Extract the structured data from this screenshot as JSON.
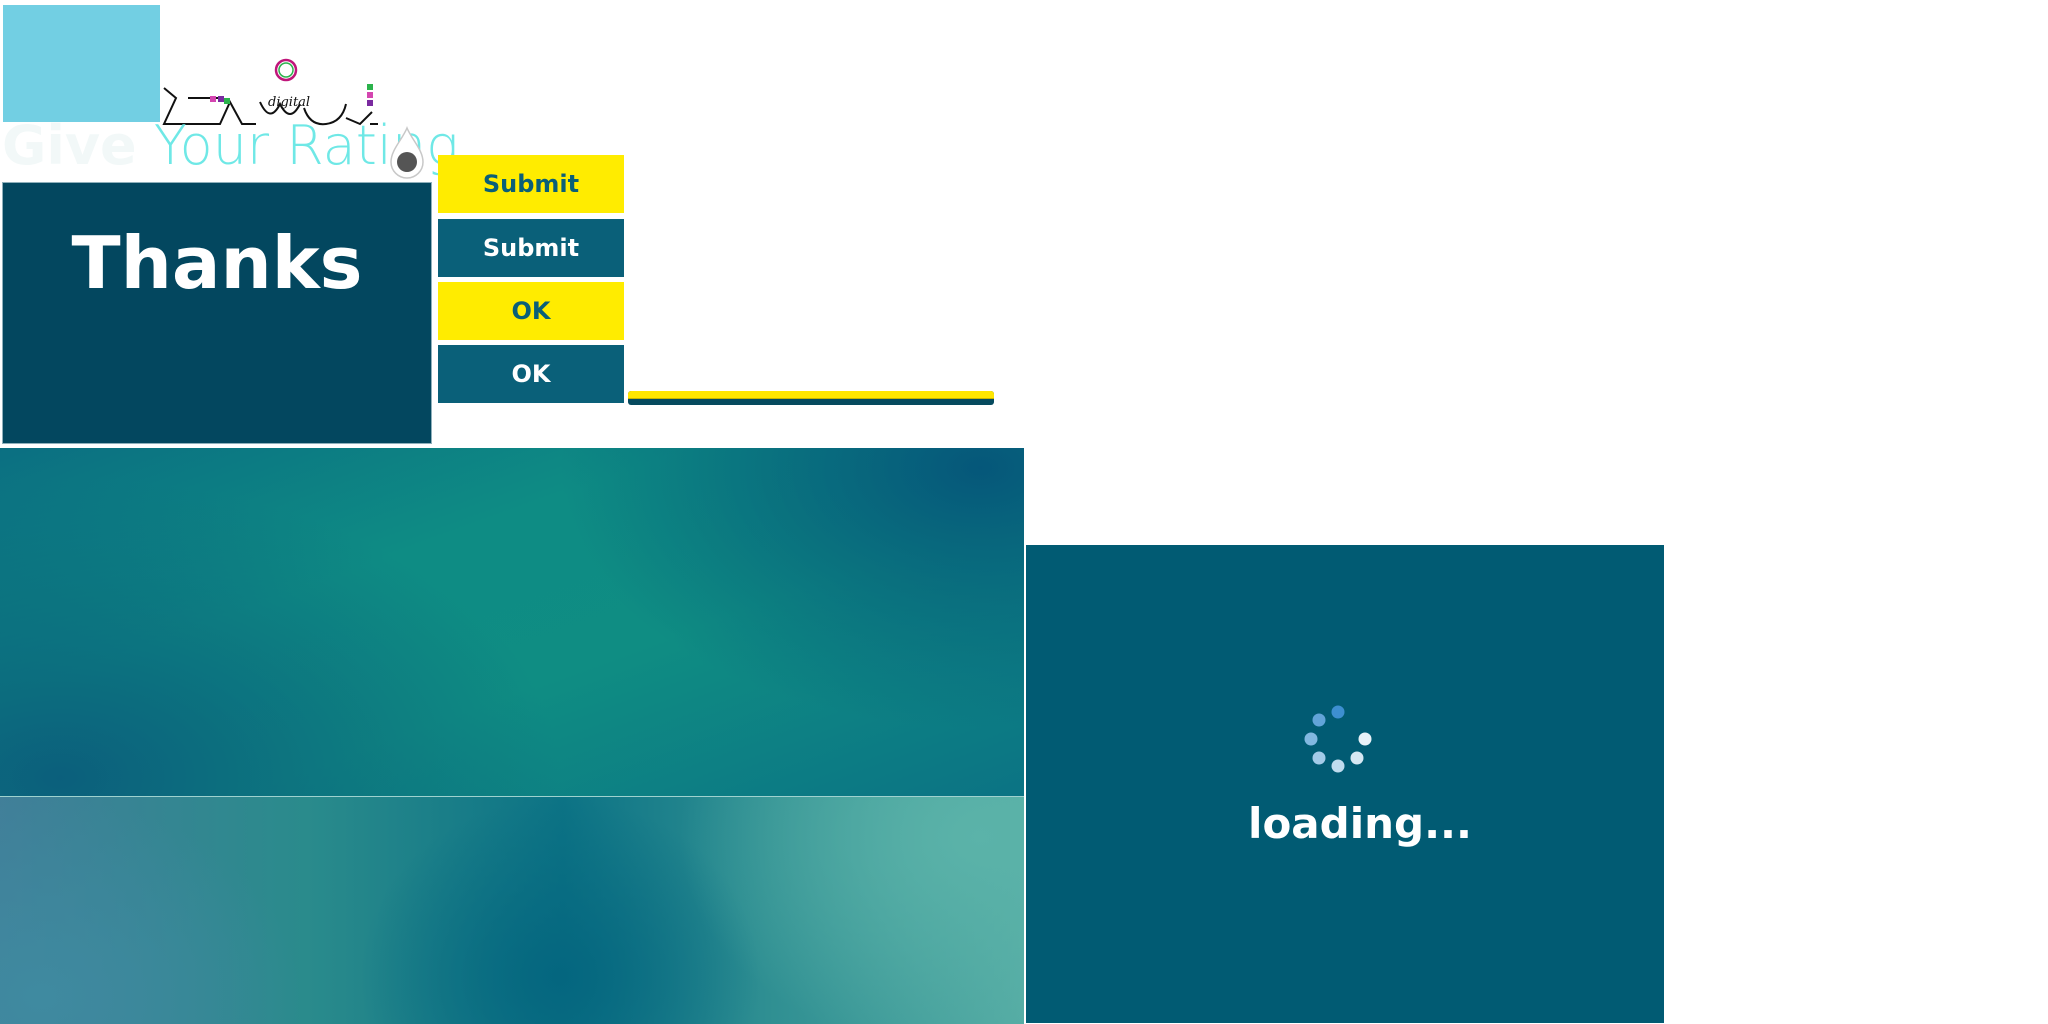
{
  "rating": {
    "title_word1": "Give",
    "title_word2": "Your Rating"
  },
  "thanks": {
    "text": "Thanks"
  },
  "buttons": [
    {
      "label": "Submit",
      "style": "yellow"
    },
    {
      "label": "Submit",
      "style": "teal"
    },
    {
      "label": "OK",
      "style": "yellow"
    },
    {
      "label": "OK",
      "style": "teal"
    }
  ],
  "logo": {
    "caption": "digital"
  },
  "progress": {
    "fraction": 1.0
  },
  "loading": {
    "text": "loading..."
  },
  "colors": {
    "accent_yellow": "#ffec00",
    "dark_teal": "#03475f",
    "button_teal": "#0a6079",
    "loading_bg": "#015b73",
    "light_blue": "#72cfe3"
  },
  "icons": [
    "drop-icon",
    "spinner-icon",
    "brand-logo"
  ]
}
